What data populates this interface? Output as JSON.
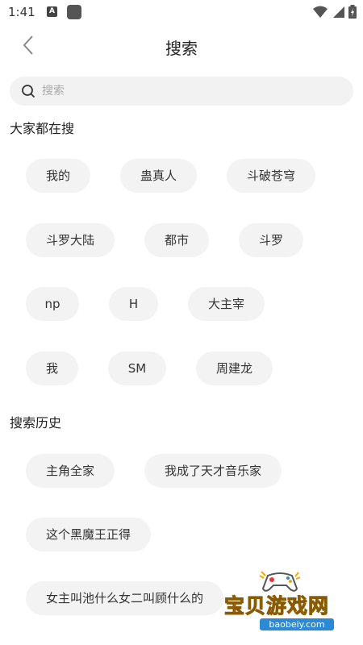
{
  "status": {
    "time": "1:41",
    "notif_letter": "A"
  },
  "nav": {
    "title": "搜索"
  },
  "search": {
    "placeholder": "搜索"
  },
  "hot": {
    "title": "大家都在搜",
    "items": [
      "我的",
      "蛊真人",
      "斗破苍穹",
      "斗罗大陆",
      "都市",
      "斗罗",
      "np",
      "H",
      "大主宰",
      "我",
      "SM",
      "周建龙"
    ]
  },
  "history": {
    "title": "搜索历史",
    "items": [
      "主角全家",
      "我成了天才音乐家",
      "这个黑魔王正得",
      "女主叫池什么女二叫顾什么的"
    ]
  },
  "watermark": {
    "text": "宝贝游戏网",
    "url": "baobeiy.com"
  }
}
